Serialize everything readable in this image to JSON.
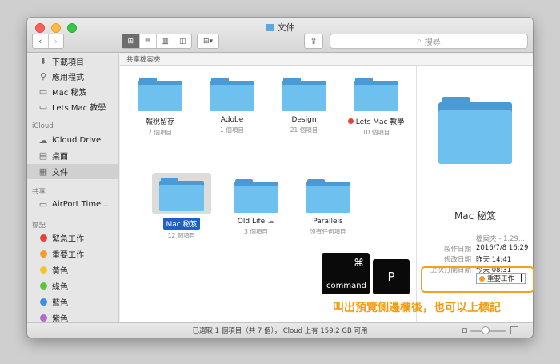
{
  "window": {
    "title": "文件"
  },
  "toolbar": {
    "back_icon": "chevron-left-icon",
    "forward_icon": "chevron-right-icon",
    "view_icons": [
      "icon-view-icon",
      "list-view-icon",
      "column-view-icon",
      "cover-flow-icon"
    ],
    "arrange_icon": "arrange-icon",
    "share_icon": "share-icon",
    "search_placeholder": "搜尋"
  },
  "sidebar": {
    "sections": [
      {
        "header": "",
        "items": [
          {
            "label": "下載項目",
            "icon": "download-icon"
          },
          {
            "label": "應用程式",
            "icon": "applications-icon"
          },
          {
            "label": "Mac 秘笈",
            "icon": "folder-icon"
          },
          {
            "label": "Lets Mac 教學",
            "icon": "folder-icon"
          }
        ]
      },
      {
        "header": "iCloud",
        "items": [
          {
            "label": "iCloud Drive",
            "icon": "cloud-icon"
          },
          {
            "label": "桌面",
            "icon": "desktop-icon"
          },
          {
            "label": "文件",
            "icon": "documents-icon",
            "selected": true
          }
        ]
      },
      {
        "header": "共享",
        "items": [
          {
            "label": "AirPort Time...",
            "icon": "network-drive-icon"
          }
        ]
      },
      {
        "header": "標記",
        "items": [
          {
            "label": "緊急工作",
            "color": "#e8403c"
          },
          {
            "label": "重要工作",
            "color": "#f59a2f"
          },
          {
            "label": "黃色",
            "color": "#f2c725"
          },
          {
            "label": "綠色",
            "color": "#5ac63c"
          },
          {
            "label": "藍色",
            "color": "#3a8fe8"
          },
          {
            "label": "紫色",
            "color": "#b06acc"
          }
        ]
      }
    ]
  },
  "path_header": "共享檔案夾",
  "files": [
    {
      "name": "報稅留存",
      "sub": "2 個項目"
    },
    {
      "name": "Adobe",
      "sub": "1 個項目"
    },
    {
      "name": "Design",
      "sub": "21 個項目"
    },
    {
      "name": "Lets Mac 教學",
      "sub": "10 個項目",
      "tag_color": "#e8403c"
    },
    {
      "name": "Mac 秘笈",
      "sub": "12 個項目",
      "selected": true
    },
    {
      "name": "Old Life",
      "sub": "3 個項目",
      "cloud": "☁"
    },
    {
      "name": "Parallels",
      "sub": "沒有任何項目"
    }
  ],
  "preview": {
    "name": "Mac 秘笈",
    "rows": [
      {
        "k": "",
        "v": "檔案夾 - 1.29..."
      },
      {
        "k": "製作日期",
        "v": "2016/7/8 16:29"
      },
      {
        "k": "修改日期",
        "v": "昨天 14:41"
      },
      {
        "k": "上次打開日期",
        "v": "今天 08:31"
      }
    ],
    "tag_label": "重要工作",
    "tag_color": "#f59a2f"
  },
  "status": {
    "text": "已選取 1 個項目（共 7 個），iCloud 上有 159.2 GB 可用"
  },
  "overlay": {
    "cmd_symbol": "⌘",
    "cmd_label": "command",
    "p_label": "P",
    "caption": "叫出預覽側邊欄後，也可以上標記",
    "highlight_color": "#f2a024"
  }
}
